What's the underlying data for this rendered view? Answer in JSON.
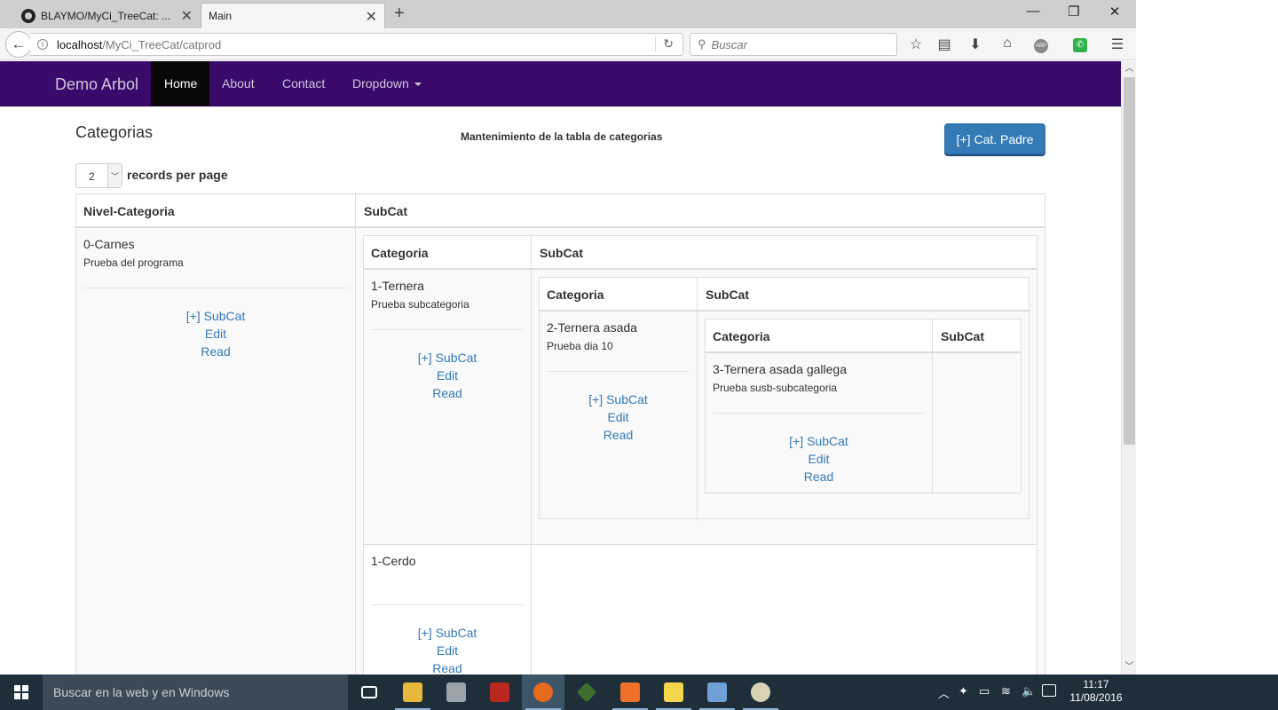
{
  "browser": {
    "tabs": [
      {
        "label": "BLAYMO/MyCi_TreeCat: ..."
      },
      {
        "label": "Main"
      }
    ],
    "url_host": "localhost",
    "url_path": "/MyCi_TreeCat/catprod",
    "search_placeholder": "Buscar"
  },
  "site": {
    "brand": "Demo Arbol",
    "nav": [
      "Home",
      "About",
      "Contact",
      "Dropdown"
    ]
  },
  "page": {
    "title": "Categorias",
    "subtitle": "Mantenimiento de la tabla de categorias",
    "add_parent_button": "[+] Cat. Padre",
    "per_page_value": "2",
    "per_page_label": "records per page"
  },
  "table": {
    "col1": "Nivel-Categoria",
    "col2": "SubCat",
    "nested_col1": "Categoria",
    "nested_col2": "SubCat",
    "rows": [
      {
        "name": "0-Carnes",
        "desc": "Prueba del programa"
      },
      {
        "name": "1-Ternera",
        "desc": "Prueba subcategoria"
      },
      {
        "name": "2-Ternera asada",
        "desc": "Prueba dia 10"
      },
      {
        "name": "3-Ternera asada gallega",
        "desc": "Prueba susb-subcategoria"
      },
      {
        "name": "1-Cerdo",
        "desc": ""
      }
    ],
    "actions": {
      "add": "[+] SubCat",
      "edit": "Edit",
      "read": "Read"
    }
  },
  "taskbar": {
    "search_placeholder": "Buscar en la web y en Windows",
    "time": "11:17",
    "date": "11/08/2016",
    "colors": {
      "bar": "#1f2f3a",
      "search": "#3b4a55"
    }
  },
  "colors": {
    "navbar": "#3a0a6b",
    "link": "#337ab7",
    "button": "#337ab7"
  }
}
